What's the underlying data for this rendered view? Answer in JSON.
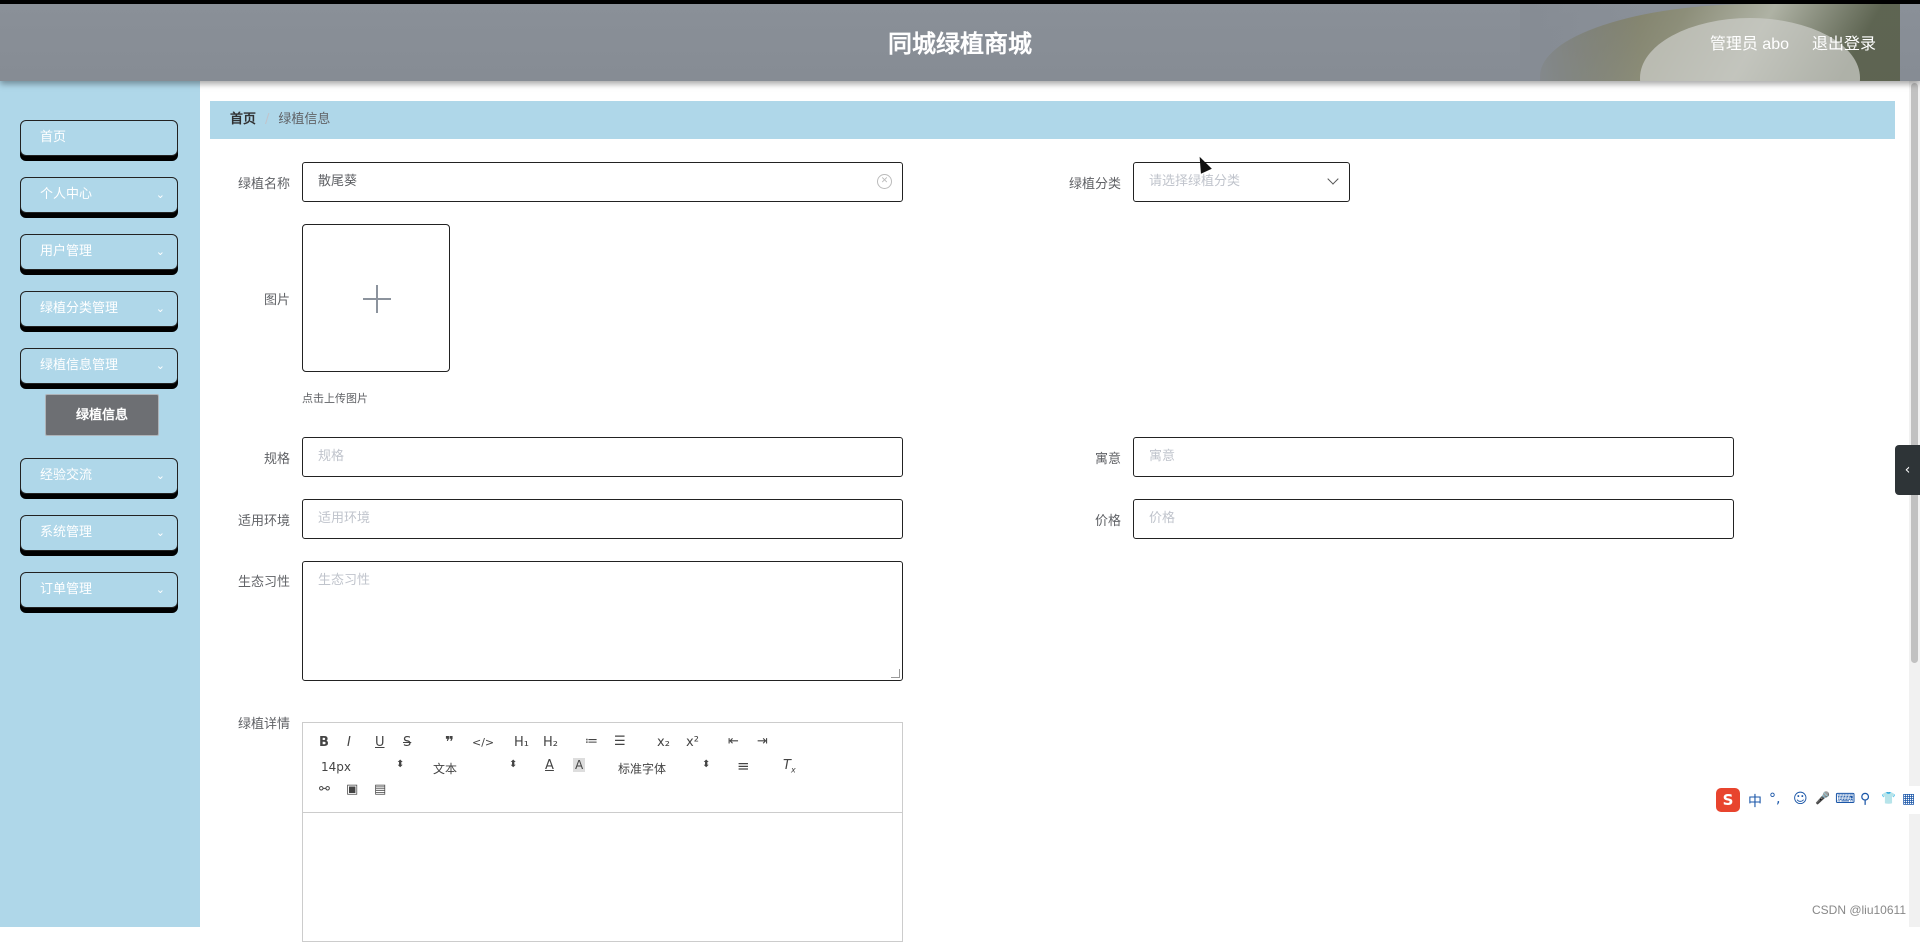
{
  "header": {
    "title": "同城绿植商城",
    "user": "管理员 abo",
    "logout": "退出登录"
  },
  "sidebar": {
    "items": [
      {
        "label": "首页",
        "has_arrow": false
      },
      {
        "label": "个人中心",
        "has_arrow": true
      },
      {
        "label": "用户管理",
        "has_arrow": true
      },
      {
        "label": "绿植分类管理",
        "has_arrow": true
      },
      {
        "label": "绿植信息管理",
        "has_arrow": true
      },
      {
        "label": "经验交流",
        "has_arrow": true
      },
      {
        "label": "系统管理",
        "has_arrow": true
      },
      {
        "label": "订单管理",
        "has_arrow": true
      }
    ],
    "active_submenu": "绿植信息"
  },
  "breadcrumb": {
    "home": "首页",
    "separator": "/",
    "current": "绿植信息"
  },
  "form": {
    "name": {
      "label": "绿植名称",
      "value": "散尾葵"
    },
    "category": {
      "label": "绿植分类",
      "placeholder": "请选择绿植分类"
    },
    "image": {
      "label": "图片",
      "tip": "点击上传图片"
    },
    "spec": {
      "label": "规格",
      "placeholder": "规格"
    },
    "meaning": {
      "label": "寓意",
      "placeholder": "寓意"
    },
    "environment": {
      "label": "适用环境",
      "placeholder": "适用环境"
    },
    "price": {
      "label": "价格",
      "placeholder": "价格"
    },
    "habit": {
      "label": "生态习性",
      "placeholder": "生态习性"
    },
    "detail": {
      "label": "绿植详情"
    }
  },
  "editor": {
    "font_size": "14px",
    "block_type": "文本",
    "font_family": "标准字体",
    "row1": [
      "B",
      "I",
      "U",
      "S",
      "❞",
      "</>",
      "H₁",
      "H₂",
      "≔",
      "☰",
      "x₂",
      "x²",
      "⇤",
      "⇥"
    ],
    "row2_icons": [
      "color-icon",
      "background-icon",
      "align-icon",
      "clean-icon"
    ],
    "row3_icons": [
      "link-icon",
      "image-icon",
      "video-icon"
    ]
  },
  "ime": {
    "items": [
      "中",
      "°,",
      "☺",
      "🎤",
      "⌨",
      "⚲",
      "👕",
      "▦"
    ]
  },
  "watermark": "CSDN @liu10611"
}
